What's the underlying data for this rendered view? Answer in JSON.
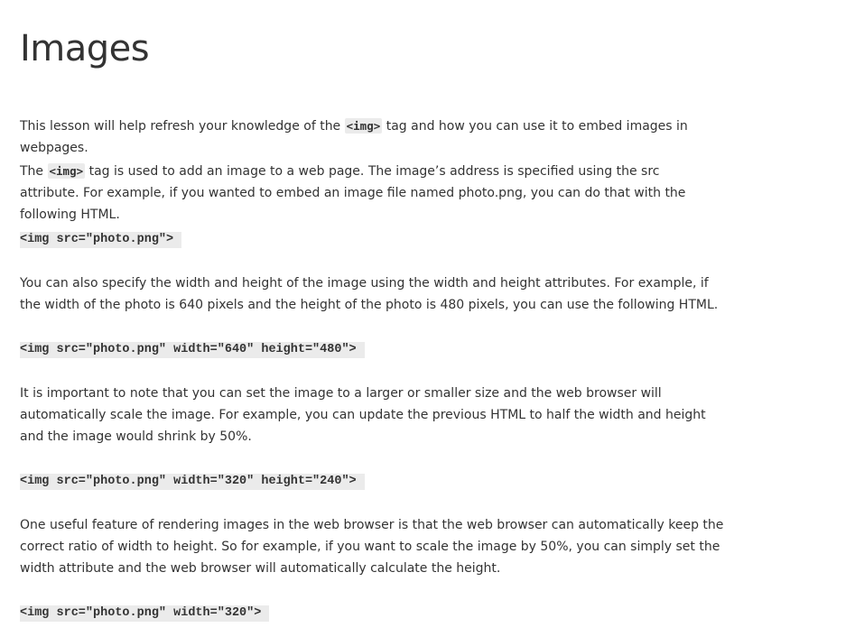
{
  "page": {
    "title": "Images"
  },
  "para1": {
    "before": "This lesson will help refresh your knowledge of the ",
    "code": "<img>",
    "after": " tag and how you can use it to embed images in webpages."
  },
  "para2": {
    "before": "The ",
    "code": "<img>",
    "after": " tag is used to add an image to a web page. The image’s address is specified using the src attribute. For example, if you wanted to embed an image file named photo.png, you can do that with the following HTML."
  },
  "code1": "<img src=\"photo.png\">",
  "para3": "You can also specify the width and height of the image using the width and height attributes. For example, if the width of the photo is 640 pixels and the height of the photo is 480 pixels, you can use the following HTML.",
  "code2": "<img src=\"photo.png\" width=\"640\" height=\"480\">",
  "para4": "It is important to note that you can set the image to a larger or smaller size and the web browser will automatically scale the image. For example, you can update the previous HTML to half the width and height and the image would shrink by 50%.",
  "code3": "<img src=\"photo.png\" width=\"320\" height=\"240\">",
  "para5": "One useful feature of rendering images in the web browser is that the web browser can automatically keep the correct ratio of width to height. So for example, if you want to scale the image by 50%, you can simply set the width attribute and the web browser will automatically calculate the height.",
  "code4": "<img src=\"photo.png\" width=\"320\">"
}
